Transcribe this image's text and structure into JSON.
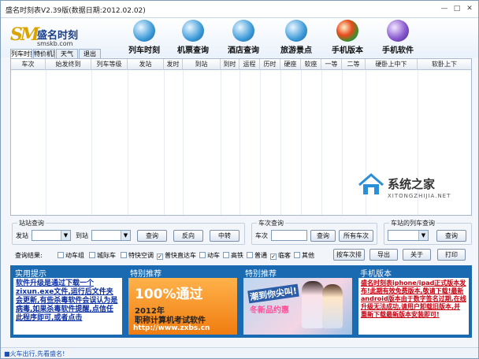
{
  "window": {
    "title": "盛名时刻表V2.39版(数据日期:2012.02.02)",
    "btn_min": "—",
    "btn_max": "□",
    "btn_close": "✕"
  },
  "logo": {
    "mark": "SM",
    "name": "盛名时刻",
    "url": "smskb.com"
  },
  "toolbar": [
    {
      "label": "列车时刻",
      "icon": "train-icon"
    },
    {
      "label": "机票查询",
      "icon": "airplane-icon"
    },
    {
      "label": "酒店查询",
      "icon": "hotel-icon"
    },
    {
      "label": "旅游景点",
      "icon": "travel-icon"
    },
    {
      "label": "手机版本",
      "icon": "windows-icon"
    },
    {
      "label": "手机软件",
      "icon": "phone-icon"
    }
  ],
  "tabs": [
    "列车时刻",
    "特价机票",
    "天气",
    "退出"
  ],
  "grid_headers": [
    "车次",
    "始发终到",
    "列车等级",
    "发站",
    "发时",
    "到站",
    "到时",
    "运程",
    "历时",
    "硬座",
    "软座",
    "一等",
    "二等",
    "硬卧上中下",
    "软卧上下"
  ],
  "watermark": {
    "name": "系统之家",
    "url": "XITONGZHIJIA.NET"
  },
  "station_query": {
    "group": "站站查询",
    "from_label": "发站",
    "to_label": "到站",
    "query_btn": "查询",
    "reverse_btn": "反向",
    "transfer_btn": "中转"
  },
  "train_query": {
    "group": "车次查询",
    "train_label": "车次",
    "query_btn": "查询",
    "all_btn": "所有车次"
  },
  "station_train_query": {
    "group": "车站的列车查询",
    "query_btn": "查询"
  },
  "filters": {
    "label": "查询结果:",
    "items": [
      {
        "label": "动车组",
        "checked": false
      },
      {
        "label": "城际车",
        "checked": false
      },
      {
        "label": "特快空调",
        "checked": false
      },
      {
        "label": "普快直达车",
        "checked": true
      },
      {
        "label": "动车",
        "checked": false
      },
      {
        "label": "高铁",
        "checked": false
      },
      {
        "label": "普通",
        "checked": false
      },
      {
        "label": "临客",
        "checked": true
      },
      {
        "label": "其他",
        "checked": false
      }
    ],
    "buttons": [
      "按车次排",
      "导出",
      "关于",
      "打印"
    ]
  },
  "panels": {
    "news": {
      "title": "实用提示",
      "text": "软件升级是通过下载一个zixun.exe文件,运行后文件夹会更新,有些杀毒软件会误认为是病毒,如果杀毒软件提醒,点信任此程序即可,或者点击"
    },
    "ad1": {
      "title": "特别推荐",
      "big": "100%通过",
      "line1": "2012年",
      "line2": "职称计算机考试软件",
      "url": "http://www.zxbs.cn"
    },
    "ad2": {
      "title": "特别推荐",
      "s1": "潮到你尖叫!",
      "s2": "冬新品约惠"
    },
    "mobile": {
      "title": "手机版本",
      "text": "盛名时刻表iphone/ipad正式版本发布!此期有效免费版本,敬请下载!最新android版本由于数字签名过期,在线升级无法成功,请用户卸载旧版本,并重新下载最新版本安装即可!"
    }
  },
  "status": "■火车出行,先看盛名!"
}
